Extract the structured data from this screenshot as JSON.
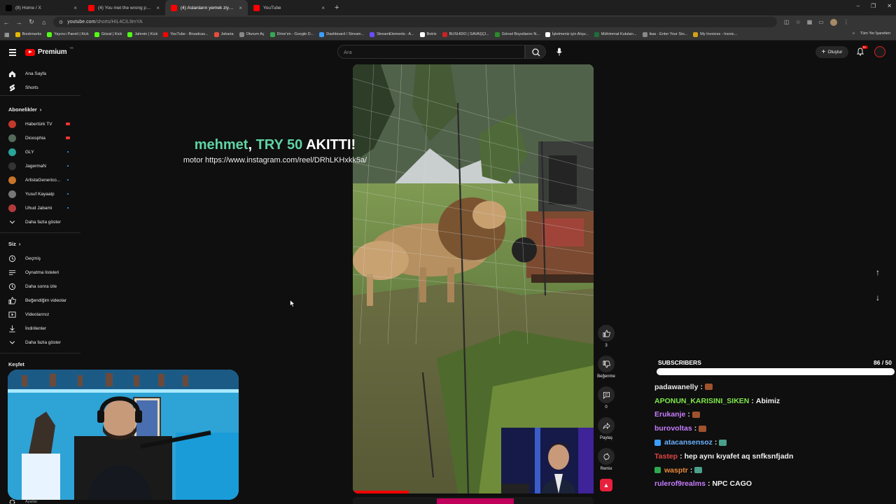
{
  "browser": {
    "tabs": [
      {
        "title": "(8) Home / X",
        "color": "#000000",
        "active": false
      },
      {
        "title": "(4) You met the wrong person",
        "color": "#ff0000",
        "active": false
      },
      {
        "title": "(4) Aslanların yemek ziyareti",
        "color": "#ff0000",
        "active": true
      },
      {
        "title": "YouTube",
        "color": "#ff0000",
        "active": false
      }
    ],
    "url_domain": "youtube.com",
    "url_path": "/shorts/HIL4CIL9mYA",
    "bookmarks": [
      {
        "label": "Bookmarks",
        "color": "#e6b800"
      },
      {
        "label": "Yayıncı Paneli | Kick",
        "color": "#53fc18"
      },
      {
        "label": "Gözat | Kick",
        "color": "#53fc18"
      },
      {
        "label": "Jahrein | Kick",
        "color": "#53fc18"
      },
      {
        "label": "YouTube - Broadcas...",
        "color": "#ff0000"
      },
      {
        "label": "Jaharia",
        "color": "#e84c3d"
      },
      {
        "label": "Oturum Aç",
        "color": "#888888"
      },
      {
        "label": "Drive'ım - Google D...",
        "color": "#34a853"
      },
      {
        "label": "Dashboard / Stream...",
        "color": "#3aa0ff"
      },
      {
        "label": "StreamElements - A...",
        "color": "#6b4cff"
      },
      {
        "label": "Botrix",
        "color": "#ffffff"
      },
      {
        "label": "BUSHIDO | SAVAŞÇI...",
        "color": "#cc2222"
      },
      {
        "label": "Görsel Boyutlarını N...",
        "color": "#2a8a2a"
      },
      {
        "label": "İşletmeniz için Alışv...",
        "color": "#ffffff"
      },
      {
        "label": "Mühimmat Kutuları...",
        "color": "#1f6e3a"
      },
      {
        "label": "ikas - Enter Your Sto...",
        "color": "#888888"
      },
      {
        "label": "My Invoices - Invoic...",
        "color": "#d4a017"
      }
    ],
    "all_bookmarks": "Tüm Yer İşaretleri"
  },
  "header": {
    "logo_text": "Premium",
    "logo_sup": "TR",
    "search_placeholder": "Ara",
    "create_label": "Oluştur",
    "notif_count": "9+"
  },
  "sidebar": {
    "top": [
      {
        "label": "Ana Sayfa",
        "icon": "home-icon"
      },
      {
        "label": "Shorts",
        "icon": "shorts-icon"
      }
    ],
    "subscriptions_title": "Abonelikler",
    "subscriptions": [
      {
        "label": "Habertürk TV",
        "color": "#c0392b",
        "live": true
      },
      {
        "label": "Dioosphia",
        "color": "#556b5a",
        "live": true
      },
      {
        "label": "GLY",
        "color": "#2aa39a",
        "live": false
      },
      {
        "label": "JagermaN",
        "color": "#333333",
        "live": false
      },
      {
        "label": "ArtistaGenerico...",
        "color": "#c8742a",
        "live": false
      },
      {
        "label": "Yusuf Kayaalp",
        "color": "#777777",
        "live": false
      },
      {
        "label": "Uhud Jabami",
        "color": "#b23a3a",
        "live": false
      }
    ],
    "show_more": "Daha fazla göster",
    "you_title": "Siz",
    "you_items": [
      {
        "label": "Geçmiş",
        "icon": "history-icon"
      },
      {
        "label": "Oynatma listeleri",
        "icon": "playlist-icon"
      },
      {
        "label": "Daha sonra izle",
        "icon": "clock-icon"
      },
      {
        "label": "Beğendiğim videolar",
        "icon": "like-icon"
      },
      {
        "label": "Videolarınız",
        "icon": "video-icon"
      },
      {
        "label": "İndirilenler",
        "icon": "download-icon"
      }
    ],
    "explore_title": "Keşfet",
    "settings": "Ayarlar"
  },
  "donation": {
    "name": "mehmet",
    "sep": ", ",
    "amount": "TRY 50",
    "action": " AKITTI!",
    "message": "motor https://www.instagram.com/reel/DRhLKHxkk5a/"
  },
  "actions": {
    "like_count": "3",
    "dislike_label": "Beğenme",
    "comment_count": "0",
    "share_label": "Paylaş",
    "remix_label": "Remix"
  },
  "subscribers": {
    "label": "SUBSCRIBERS",
    "current": 86,
    "goal": 50,
    "text": "86 / 50"
  },
  "chat": [
    {
      "user": "padawanelly",
      "color": "#e8e8e8",
      "text": "",
      "emote": "#a0522d",
      "badge": null
    },
    {
      "user": "APONUN_KARISINI_SIKEN",
      "color": "#7ee84a",
      "text": "Abimiz",
      "emote": null,
      "badge": null
    },
    {
      "user": "Erukanje",
      "color": "#c77dff",
      "text": "",
      "emote": "#a0522d",
      "badge": null
    },
    {
      "user": "burovoltas",
      "color": "#c77dff",
      "text": "",
      "emote": "#a0522d",
      "badge": null
    },
    {
      "user": "atacansensoz",
      "color": "#6ab0ff",
      "text": "",
      "emote": "#4aa08a",
      "badge": "#3aa0ff"
    },
    {
      "user": "Tastep",
      "color": "#e04444",
      "text": "hep aynı kıyafet aq snfksnfjadn",
      "emote": null,
      "badge": null
    },
    {
      "user": "wasptr",
      "color": "#e8893a",
      "text": "",
      "emote": "#4aa08a",
      "badge": "#2fa84f"
    },
    {
      "user": "rulerof9realms",
      "color": "#c77dff",
      "text": "NPC CAGO",
      "emote": null,
      "badge": null
    }
  ]
}
